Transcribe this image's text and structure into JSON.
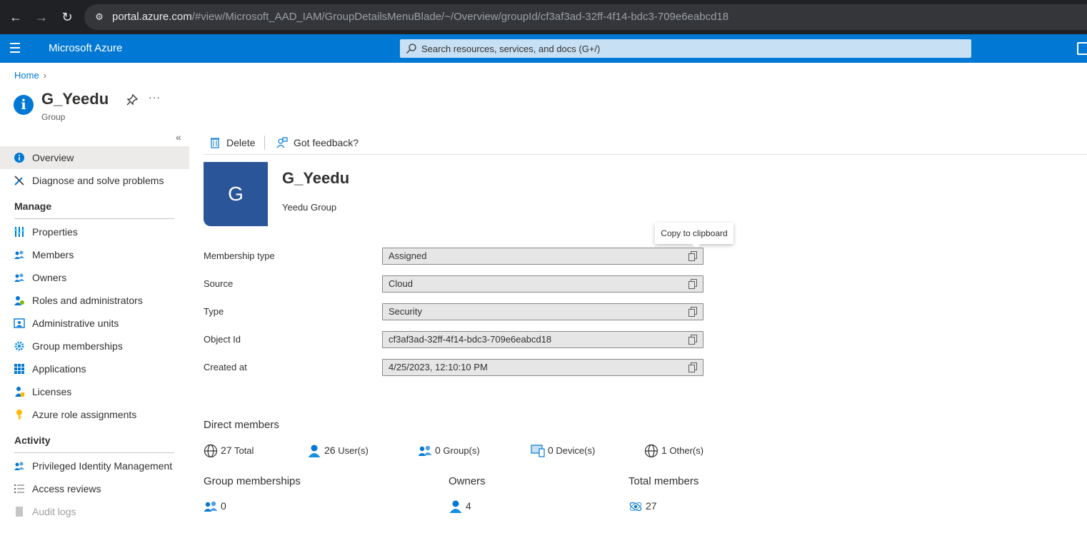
{
  "browser": {
    "url_host": "portal.azure.com",
    "url_path": "/#view/Microsoft_AAD_IAM/GroupDetailsMenuBlade/~/Overview/groupId/cf3af3ad-32ff-4f14-bdc3-709e6eabcd18"
  },
  "topbar": {
    "brand": "Microsoft Azure",
    "search_placeholder": "Search resources, services, and docs (G+/)",
    "accent_color": "#0078d4"
  },
  "breadcrumb": {
    "home": "Home"
  },
  "header": {
    "title": "G_Yeedu",
    "subtitle": "Group",
    "more": "···"
  },
  "nav": {
    "collapse": "«",
    "top_items": [
      {
        "label": "Overview",
        "icon": "info-icon"
      },
      {
        "label": "Diagnose and solve problems",
        "icon": "wrench-icon"
      }
    ],
    "manage_title": "Manage",
    "manage_items": [
      {
        "label": "Properties",
        "icon": "properties-icon"
      },
      {
        "label": "Members",
        "icon": "members-icon"
      },
      {
        "label": "Owners",
        "icon": "owners-icon"
      },
      {
        "label": "Roles and administrators",
        "icon": "roles-icon"
      },
      {
        "label": "Administrative units",
        "icon": "admin-units-icon"
      },
      {
        "label": "Group memberships",
        "icon": "gear-icon"
      },
      {
        "label": "Applications",
        "icon": "grid-icon"
      },
      {
        "label": "Licenses",
        "icon": "license-icon"
      },
      {
        "label": "Azure role assignments",
        "icon": "key-icon"
      }
    ],
    "activity_title": "Activity",
    "activity_items": [
      {
        "label": "Privileged Identity Management",
        "icon": "pim-icon"
      },
      {
        "label": "Access reviews",
        "icon": "list-icon"
      },
      {
        "label": "Audit logs",
        "icon": "audit-icon"
      }
    ]
  },
  "commands": {
    "delete": "Delete",
    "feedback": "Got feedback?"
  },
  "group": {
    "initial": "G",
    "name": "G_Yeedu",
    "description": "Yeedu Group",
    "avatar_color": "#2a5599"
  },
  "tooltip": "Copy to clipboard",
  "properties": [
    {
      "label": "Membership type",
      "value": "Assigned"
    },
    {
      "label": "Source",
      "value": "Cloud"
    },
    {
      "label": "Type",
      "value": "Security"
    },
    {
      "label": "Object Id",
      "value": "cf3af3ad-32ff-4f14-bdc3-709e6eabcd18"
    },
    {
      "label": "Created at",
      "value": "4/25/2023, 12:10:10 PM"
    }
  ],
  "direct_members": {
    "title": "Direct members",
    "total": {
      "value": "27",
      "label": "Total"
    },
    "users": {
      "value": "26",
      "label": "User(s)"
    },
    "groups": {
      "value": "0",
      "label": "Group(s)"
    },
    "devices": {
      "value": "0",
      "label": "Device(s)"
    },
    "others": {
      "value": "1",
      "label": "Other(s)"
    }
  },
  "summary": {
    "group_memberships": {
      "title": "Group memberships",
      "value": "0"
    },
    "owners": {
      "title": "Owners",
      "value": "4"
    },
    "total_members": {
      "title": "Total members",
      "value": "27"
    }
  }
}
